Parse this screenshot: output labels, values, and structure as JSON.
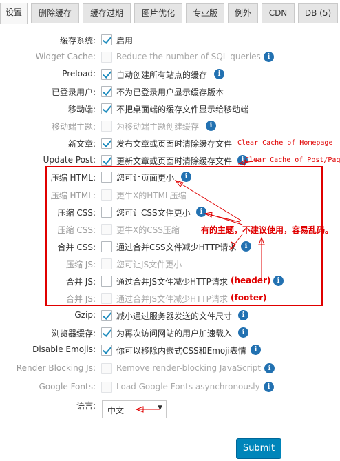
{
  "tabs": [
    {
      "label": "设置",
      "active": true
    },
    {
      "label": "删除缓存"
    },
    {
      "label": "缓存过期"
    },
    {
      "label": "图片优化"
    },
    {
      "label": "专业版"
    },
    {
      "label": "例外"
    },
    {
      "label": "CDN"
    },
    {
      "label": "DB (5)"
    }
  ],
  "rows": [
    {
      "label": "缓存系统:",
      "checked": true,
      "disabled": false,
      "desc": "启用",
      "info": false
    },
    {
      "label": "Widget Cache:",
      "checked": false,
      "disabled": true,
      "desc": "Reduce the number of SQL queries",
      "info": true
    },
    {
      "label": "Preload:",
      "checked": true,
      "disabled": false,
      "desc": "自动创建所有站点的缓存",
      "info": true
    },
    {
      "label": "已登录用户:",
      "checked": true,
      "disabled": false,
      "desc": "不为已登录用户显示缓存版本",
      "info": false
    },
    {
      "label": "移动端:",
      "checked": true,
      "disabled": false,
      "desc": "不把桌面端的缓存文件显示给移动端",
      "info": false
    },
    {
      "label": "移动端主题:",
      "checked": false,
      "disabled": true,
      "desc": "为移动端主题创建缓存",
      "info": true
    },
    {
      "label": "新文章:",
      "checked": true,
      "disabled": false,
      "desc": "发布文章或页面时清除缓存文件",
      "info": false
    },
    {
      "label": "Update Post:",
      "checked": true,
      "disabled": false,
      "desc": "更新文章或页面时清除缓存文件",
      "info": true
    },
    {
      "label": "压缩 HTML:",
      "checked": false,
      "disabled": false,
      "desc": "您可让页面更小",
      "info": true
    },
    {
      "label": "压缩 HTML:",
      "checked": false,
      "disabled": true,
      "desc": "更牛X的HTML压缩",
      "info": false
    },
    {
      "label": "压缩 CSS:",
      "checked": false,
      "disabled": false,
      "desc": "您可让CSS文件更小",
      "info": true
    },
    {
      "label": "压缩 CSS:",
      "checked": false,
      "disabled": true,
      "desc": "更牛X的CSS压缩",
      "info": false
    },
    {
      "label": "合并 CSS:",
      "checked": false,
      "disabled": false,
      "desc": "通过合并CSS文件减少HTTP请求",
      "info": true
    },
    {
      "label": "压缩 JS:",
      "checked": false,
      "disabled": true,
      "desc": "您可让JS文件更小",
      "info": false
    },
    {
      "label": "合并 JS:",
      "checked": false,
      "disabled": false,
      "desc": "通过合并JS文件减少HTTP请求",
      "info": true
    },
    {
      "label": "合并 JS:",
      "checked": false,
      "disabled": true,
      "desc": "通过合并JS文件减少HTTP请求",
      "info": false
    },
    {
      "label": "Gzip:",
      "checked": true,
      "disabled": false,
      "desc": "减小通过服务器发送的文件尺寸",
      "info": true
    },
    {
      "label": "浏览器缓存:",
      "checked": true,
      "disabled": false,
      "desc": "为再次访问网站的用户加速载入",
      "info": true
    },
    {
      "label": "Disable Emojis:",
      "checked": true,
      "disabled": false,
      "desc": "你可以移除内嵌式CSS和Emoji表情",
      "info": true
    },
    {
      "label": "Render Blocking Js:",
      "checked": false,
      "disabled": true,
      "desc": "Remove render-blocking JavaScript",
      "info": true
    },
    {
      "label": "Google Fonts:",
      "checked": false,
      "disabled": true,
      "desc": "Load Google Fonts asynchronously",
      "info": true
    }
  ],
  "annotations": {
    "clear_home": "Clear Cache of Homepage",
    "clear_post": "Clear Cache of Post/Pag",
    "warning": "有的主题，不建议使用，容易乱码。",
    "header": "(header)",
    "footer": "(footer)"
  },
  "language": {
    "label": "语言:",
    "selected": "中文"
  },
  "submit_label": "Submit",
  "colors": {
    "accent": "#0085ba",
    "annotation": "#e00000",
    "info": "#2271b1"
  }
}
